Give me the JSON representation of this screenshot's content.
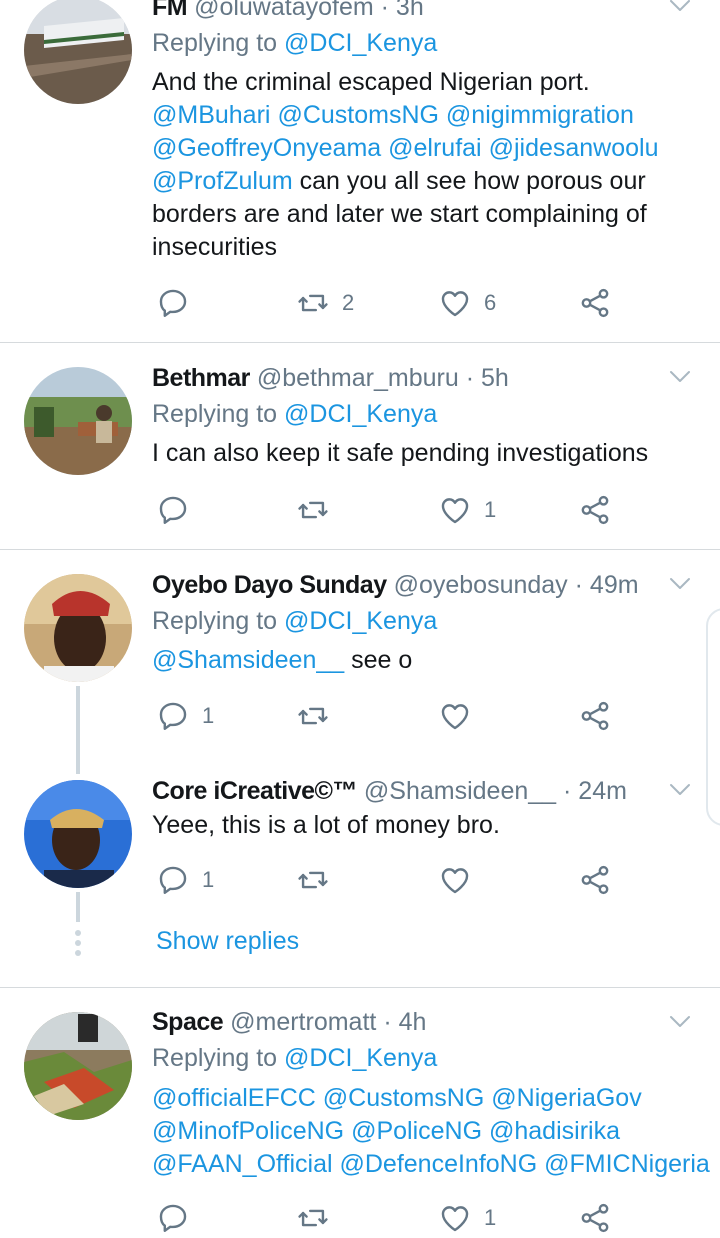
{
  "tweets": [
    {
      "name": "FM",
      "handle": "@oluwatayofem",
      "time": "· 3h",
      "replying_label": "Replying to",
      "replying_handle": "@DCI_Kenya",
      "mentions": [
        "@MBuhari",
        "@CustomsNG",
        "@nigimmigration",
        "@GeoffreyOnyeama",
        "@elrufai",
        "@jidesanwoolu",
        "@ProfZulum"
      ],
      "text_before": "And the criminal escaped Nigerian port.",
      "text_after": "can you all see how porous our borders are and later we start complaining of insecurities",
      "reply_count": "",
      "retweet_count": "2",
      "like_count": "6"
    },
    {
      "name": "Bethmar",
      "handle": "@bethmar_mburu",
      "time": "· 5h",
      "replying_label": "Replying to",
      "replying_handle": "@DCI_Kenya",
      "text": "I can also keep it safe pending investigations",
      "reply_count": "",
      "retweet_count": "",
      "like_count": "1"
    },
    {
      "name": "Oyebo Dayo Sunday",
      "handle": "@oyebosunday",
      "time": "· 49m",
      "replying_label": "Replying to",
      "replying_handle": "@DCI_Kenya",
      "mention": "@Shamsideen__",
      "text": "see o",
      "reply_count": "1",
      "retweet_count": "",
      "like_count": ""
    },
    {
      "name": "Core iCreative©™",
      "handle": "@Shamsideen__",
      "time": "· 24m",
      "text": "Yeee, this is a lot of money bro.",
      "reply_count": "1",
      "retweet_count": "",
      "like_count": ""
    },
    {
      "name": "Space",
      "handle": "@mertromatt",
      "time": "· 4h",
      "replying_label": "Replying to",
      "replying_handle": "@DCI_Kenya",
      "mentions": [
        "@officialEFCC",
        "@CustomsNG",
        "@NigeriaGov",
        "@MinofPoliceNG",
        "@PoliceNG",
        "@hadisirika",
        "@FAAN_Official",
        "@DefenceInfoNG",
        "@FMICNigeria"
      ],
      "like_count": "1"
    }
  ],
  "show_replies_label": "Show replies",
  "icons": [
    "reply-icon",
    "retweet-icon",
    "like-icon",
    "share-icon",
    "chevron-down-icon"
  ],
  "colors": {
    "link": "#1b95e0",
    "muted": "#657786",
    "text": "#14171a"
  }
}
